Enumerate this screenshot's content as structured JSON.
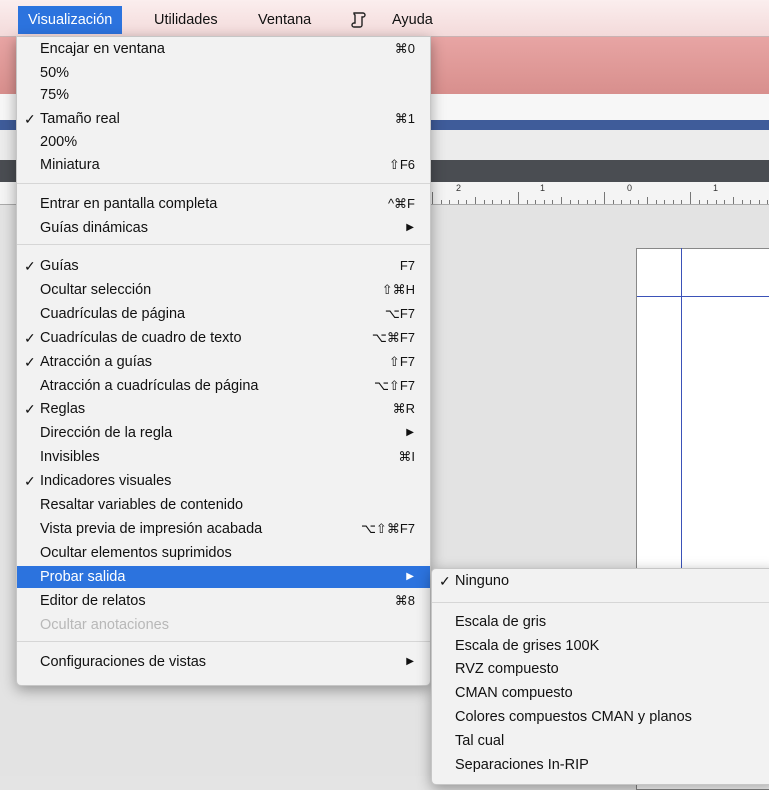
{
  "menubar": {
    "items": [
      "Visualización",
      "Utilidades",
      "Ventana",
      "Ayuda"
    ],
    "script_icon": "script-scroll-icon"
  },
  "ruler": {
    "labels": [
      "2",
      "1",
      "0",
      "1"
    ]
  },
  "main_menu": {
    "items": [
      {
        "label": "Encajar en ventana",
        "check": "",
        "shortcut": "⌘0"
      },
      {
        "label": "50%",
        "check": "",
        "shortcut": ""
      },
      {
        "label": "75%",
        "check": "",
        "shortcut": ""
      },
      {
        "label": "Tamaño real",
        "check": "✓",
        "shortcut": "⌘1"
      },
      {
        "label": "200%",
        "check": "",
        "shortcut": ""
      },
      {
        "label": "Miniatura",
        "check": "",
        "shortcut": "⇧F6"
      },
      {
        "label": "Entrar en pantalla completa",
        "check": "",
        "shortcut": "^⌘F"
      },
      {
        "label": "Guías dinámicas",
        "check": "",
        "shortcut": "▶"
      },
      {
        "label": "Guías",
        "check": "✓",
        "shortcut": "F7"
      },
      {
        "label": "Ocultar selección",
        "check": "",
        "shortcut": "⇧⌘H"
      },
      {
        "label": "Cuadrículas de página",
        "check": "",
        "shortcut": "⌥F7"
      },
      {
        "label": "Cuadrículas de cuadro de texto",
        "check": "✓",
        "shortcut": "⌥⌘F7"
      },
      {
        "label": "Atracción a guías",
        "check": "✓",
        "shortcut": "⇧F7"
      },
      {
        "label": "Atracción a cuadrículas de página",
        "check": "",
        "shortcut": "⌥⇧F7"
      },
      {
        "label": "Reglas",
        "check": "✓",
        "shortcut": "⌘R"
      },
      {
        "label": "Dirección de la regla",
        "check": "",
        "shortcut": "▶"
      },
      {
        "label": "Invisibles",
        "check": "",
        "shortcut": "⌘I"
      },
      {
        "label": "Indicadores visuales",
        "check": "✓",
        "shortcut": ""
      },
      {
        "label": "Resaltar variables de contenido",
        "check": "",
        "shortcut": ""
      },
      {
        "label": "Vista previa de impresión acabada",
        "check": "",
        "shortcut": "⌥⇧⌘F7"
      },
      {
        "label": "Ocultar elementos suprimidos",
        "check": "",
        "shortcut": ""
      },
      {
        "label": "Probar salida",
        "check": "",
        "shortcut": "▶"
      },
      {
        "label": "Editor de relatos",
        "check": "",
        "shortcut": "⌘8"
      },
      {
        "label": "Ocultar anotaciones",
        "check": "",
        "shortcut": ""
      },
      {
        "label": "Configuraciones de vistas",
        "check": "",
        "shortcut": "▶"
      }
    ]
  },
  "sub_menu": {
    "items": [
      {
        "label": "Ninguno",
        "check": "✓"
      },
      {
        "label": "Escala de gris",
        "check": ""
      },
      {
        "label": "Escala de grises 100K",
        "check": ""
      },
      {
        "label": "RVZ compuesto",
        "check": ""
      },
      {
        "label": "CMAN compuesto",
        "check": ""
      },
      {
        "label": "Colores compuestos CMAN y planos",
        "check": ""
      },
      {
        "label": "Tal cual",
        "check": ""
      },
      {
        "label": "Separaciones In-RIP",
        "check": ""
      }
    ]
  },
  "colors": {
    "highlight": "#2c73de",
    "guide": "#3b52b8"
  }
}
